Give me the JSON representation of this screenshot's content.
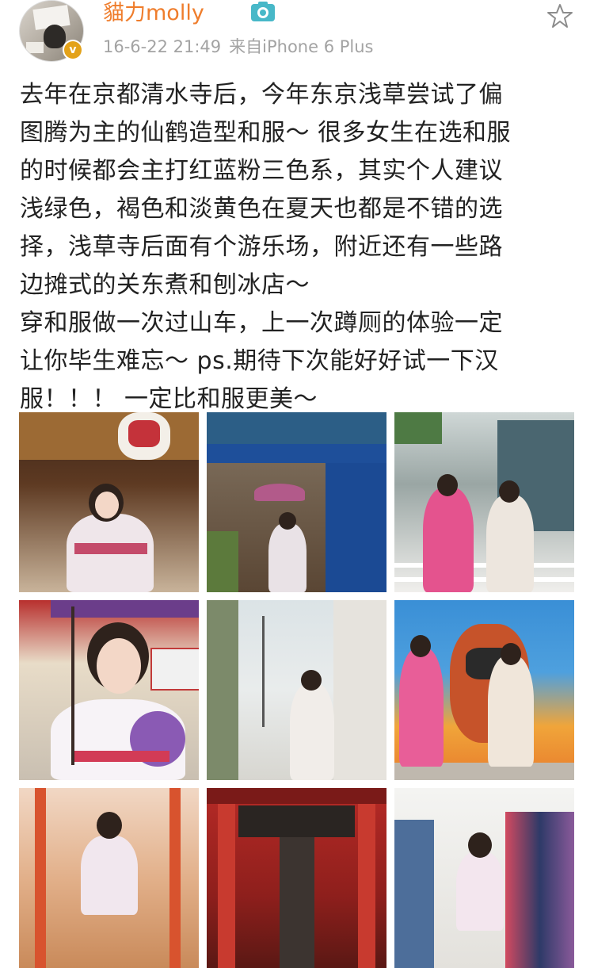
{
  "header": {
    "username": "貓力molly",
    "timestamp": "16-6-22 21:49",
    "source": "来自iPhone 6 Plus",
    "icons": [
      "avatar",
      "verified-badge-icon",
      "vip-camera-icon",
      "favorite-star-icon"
    ],
    "colors": {
      "username": "#ef7d2c",
      "meta": "#a3a3a3",
      "badge": "#e3a21a",
      "camera": "#48b8c8"
    }
  },
  "post": {
    "lines": [
      "去年在京都清水寺后，今年东京浅草尝试了偏",
      "图腾为主的仙鹤造型和服～ 很多女生在选和服",
      "的时候都会主打红蓝粉三色系，其实个人建议",
      "浅绿色，褐色和淡黄色在夏天也都是不错的选",
      "择，浅草寺后面有个游乐场，附近还有一些路",
      "边摊式的关东煮和刨冰店～",
      "穿和服做一次过山车，上一次蹲厕的体验一定",
      "让你毕生难忘～ ps.期待下次能好好试一下汉",
      "服！！！ 一定比和服更美～"
    ]
  },
  "photos": [
    {
      "name": "photo-lantern-shop"
    },
    {
      "name": "photo-shop-front-umbrella"
    },
    {
      "name": "photo-two-girls-crosswalk"
    },
    {
      "name": "photo-closeup-umbrella"
    },
    {
      "name": "photo-street-back-view"
    },
    {
      "name": "photo-two-girls-mural"
    },
    {
      "name": "photo-shopping-arcade"
    },
    {
      "name": "photo-red-temple-gate"
    },
    {
      "name": "photo-kimono-rack"
    }
  ]
}
